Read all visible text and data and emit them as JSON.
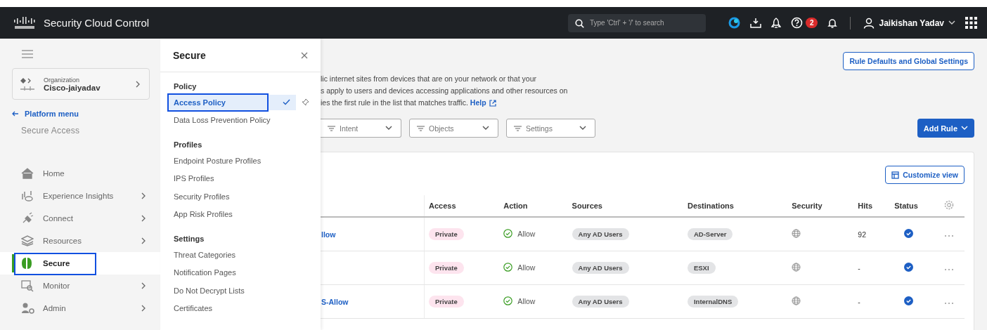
{
  "top_bar": {
    "brand": "Security Cloud Control",
    "search": {
      "placeholder": "Type 'Ctrl' + '/' to search"
    },
    "help_badge": "2",
    "user": "Jaikishan Yadav"
  },
  "sidebar": {
    "organization_label": "Organization",
    "organization_name": "Cisco-jaiyadav",
    "back_link": "Platform menu",
    "section_title": "Secure Access",
    "items": [
      {
        "label": "Home",
        "expandable": false,
        "selected": false
      },
      {
        "label": "Experience Insights",
        "expandable": true,
        "selected": false
      },
      {
        "label": "Connect",
        "expandable": true,
        "selected": false
      },
      {
        "label": "Resources",
        "expandable": true,
        "selected": false
      },
      {
        "label": "Secure",
        "expandable": false,
        "selected": true
      },
      {
        "label": "Monitor",
        "expandable": true,
        "selected": false
      },
      {
        "label": "Admin",
        "expandable": true,
        "selected": false
      }
    ]
  },
  "flyout": {
    "title": "Secure",
    "groups": [
      {
        "heading": "Policy",
        "items": [
          {
            "label": "Access Policy",
            "selected": true
          },
          {
            "label": "Data Loss Prevention Policy",
            "selected": false
          }
        ]
      },
      {
        "heading": "Profiles",
        "items": [
          {
            "label": "Endpoint Posture Profiles",
            "selected": false
          },
          {
            "label": "IPS Profiles",
            "selected": false
          },
          {
            "label": "Security Profiles",
            "selected": false
          },
          {
            "label": "App Risk Profiles",
            "selected": false
          }
        ]
      },
      {
        "heading": "Settings",
        "items": [
          {
            "label": "Threat Categories",
            "selected": false
          },
          {
            "label": "Notification Pages",
            "selected": false
          },
          {
            "label": "Do Not Decrypt Lists",
            "selected": false
          },
          {
            "label": "Certificates",
            "selected": false
          }
        ]
      }
    ]
  },
  "main": {
    "settings_button": "Rule Defaults and Global Settings",
    "description_lines": [
      "lic internet sites from devices that are on your network or that your",
      "s apply to users and devices accessing applications and other resources on",
      "ies the first rule in the list that matches traffic."
    ],
    "help_link": "Help",
    "filters": [
      "Intent",
      "Objects",
      "Settings"
    ],
    "add_rule_button": "Add Rule",
    "customize_button": "Customize view",
    "table": {
      "columns": [
        "Access",
        "Action",
        "Sources",
        "Destinations",
        "Security",
        "Hits",
        "Status"
      ],
      "rows": [
        {
          "name": "llow",
          "access": "Private",
          "action": "Allow",
          "source": "Any AD Users",
          "destination": "AD-Server",
          "hits": "92",
          "enabled": true
        },
        {
          "access": "Private",
          "action": "Allow",
          "source": "Any AD Users",
          "destination": "ESXI",
          "hits": "-",
          "enabled": true
        },
        {
          "name": "S-Allow",
          "access": "Private",
          "action": "Allow",
          "source": "Any AD Users",
          "destination": "InternalDNS",
          "hits": "-",
          "enabled": true
        }
      ]
    }
  }
}
